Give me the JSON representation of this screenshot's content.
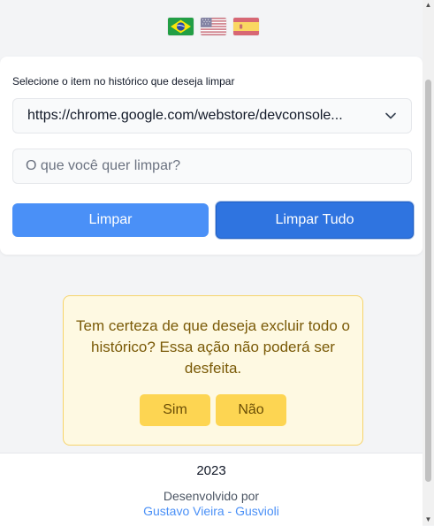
{
  "languages": [
    {
      "icon": "flag-brazil-icon",
      "active": true
    },
    {
      "icon": "flag-usa-icon",
      "active": false
    },
    {
      "icon": "flag-spain-icon",
      "active": false
    }
  ],
  "card": {
    "label": "Selecione o item no histórico que deseja limpar",
    "select_value": "https://chrome.google.com/webstore/devconsole...",
    "input_placeholder": "O que você quer limpar?",
    "input_value": "",
    "clear_button": "Limpar",
    "clear_all_button": "Limpar Tudo"
  },
  "confirm": {
    "message": "Tem certeza de que deseja excluir todo o histórico? Essa ação não poderá ser desfeita.",
    "yes_button": "Sim",
    "no_button": "Não"
  },
  "footer": {
    "year": "2023",
    "developed_by": "Desenvolvido por",
    "author_link": "Gustavo Vieira - Gusvioli"
  },
  "colors": {
    "primary": "#4a90f7",
    "primary_dark": "#2f74e0",
    "warning_bg": "#fef9e2",
    "warning_border": "#f6d46c",
    "warning_button": "#fdd552",
    "warning_text": "#7a5a07"
  }
}
